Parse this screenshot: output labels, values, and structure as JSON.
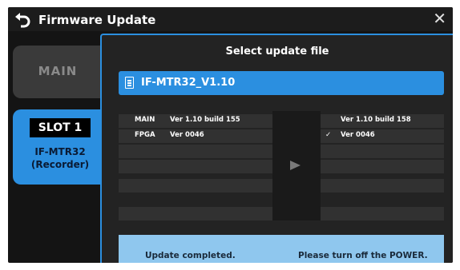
{
  "titlebar": {
    "title": "Firmware Update",
    "back_icon": "back-arrow-icon",
    "close_label": "✕"
  },
  "tabs": {
    "main_label": "MAIN",
    "slot_label": "SLOT 1",
    "slot_device_line1": "IF-MTR32",
    "slot_device_line2": "(Recorder)"
  },
  "dialog": {
    "title": "Select update file",
    "file_name": "IF-MTR32_V1.10",
    "file_icon": "document-icon",
    "rows": [
      {
        "name": "MAIN",
        "current": "Ver 1.10 build 155",
        "check": "",
        "new": "Ver 1.10 build 158"
      },
      {
        "name": "FPGA",
        "current": "Ver 0046",
        "check": "✓",
        "new": "Ver 0046"
      },
      {
        "name": "",
        "current": "",
        "check": "",
        "new": ""
      },
      {
        "name": "",
        "current": "",
        "check": "",
        "new": ""
      },
      {
        "name": "",
        "current": "",
        "check": "",
        "new": ""
      },
      {
        "name": "",
        "current": "",
        "check": "",
        "new": ""
      }
    ],
    "arrow_icon": "play-arrow-icon"
  },
  "status": {
    "message_left": "Update completed.",
    "message_right": "Please turn off the POWER."
  },
  "colors": {
    "accent": "#2b8fe0",
    "status_background": "#8fc7ee",
    "screen_background": "#141414"
  }
}
